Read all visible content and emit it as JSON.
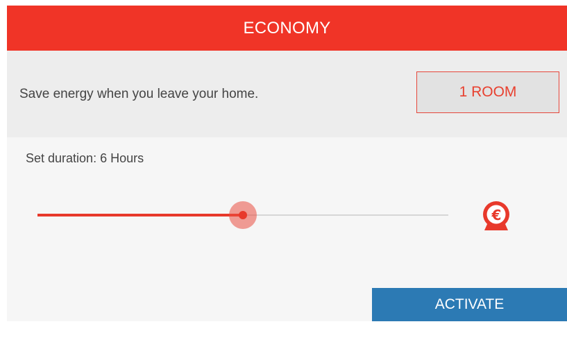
{
  "header": {
    "title": "ECONOMY"
  },
  "info": {
    "description": "Save energy when you leave your home.",
    "room_button_label": "1 ROOM"
  },
  "duration": {
    "label": "Set duration: 6 Hours",
    "slider_fraction": 0.5
  },
  "icons": {
    "cost": "euro-savings-icon"
  },
  "actions": {
    "activate_label": "ACTIVATE"
  },
  "colors": {
    "accent_red": "#f03427",
    "activate_blue": "#2c7ab4",
    "panel_bg": "#f6f6f6",
    "band_bg": "#ededed"
  }
}
